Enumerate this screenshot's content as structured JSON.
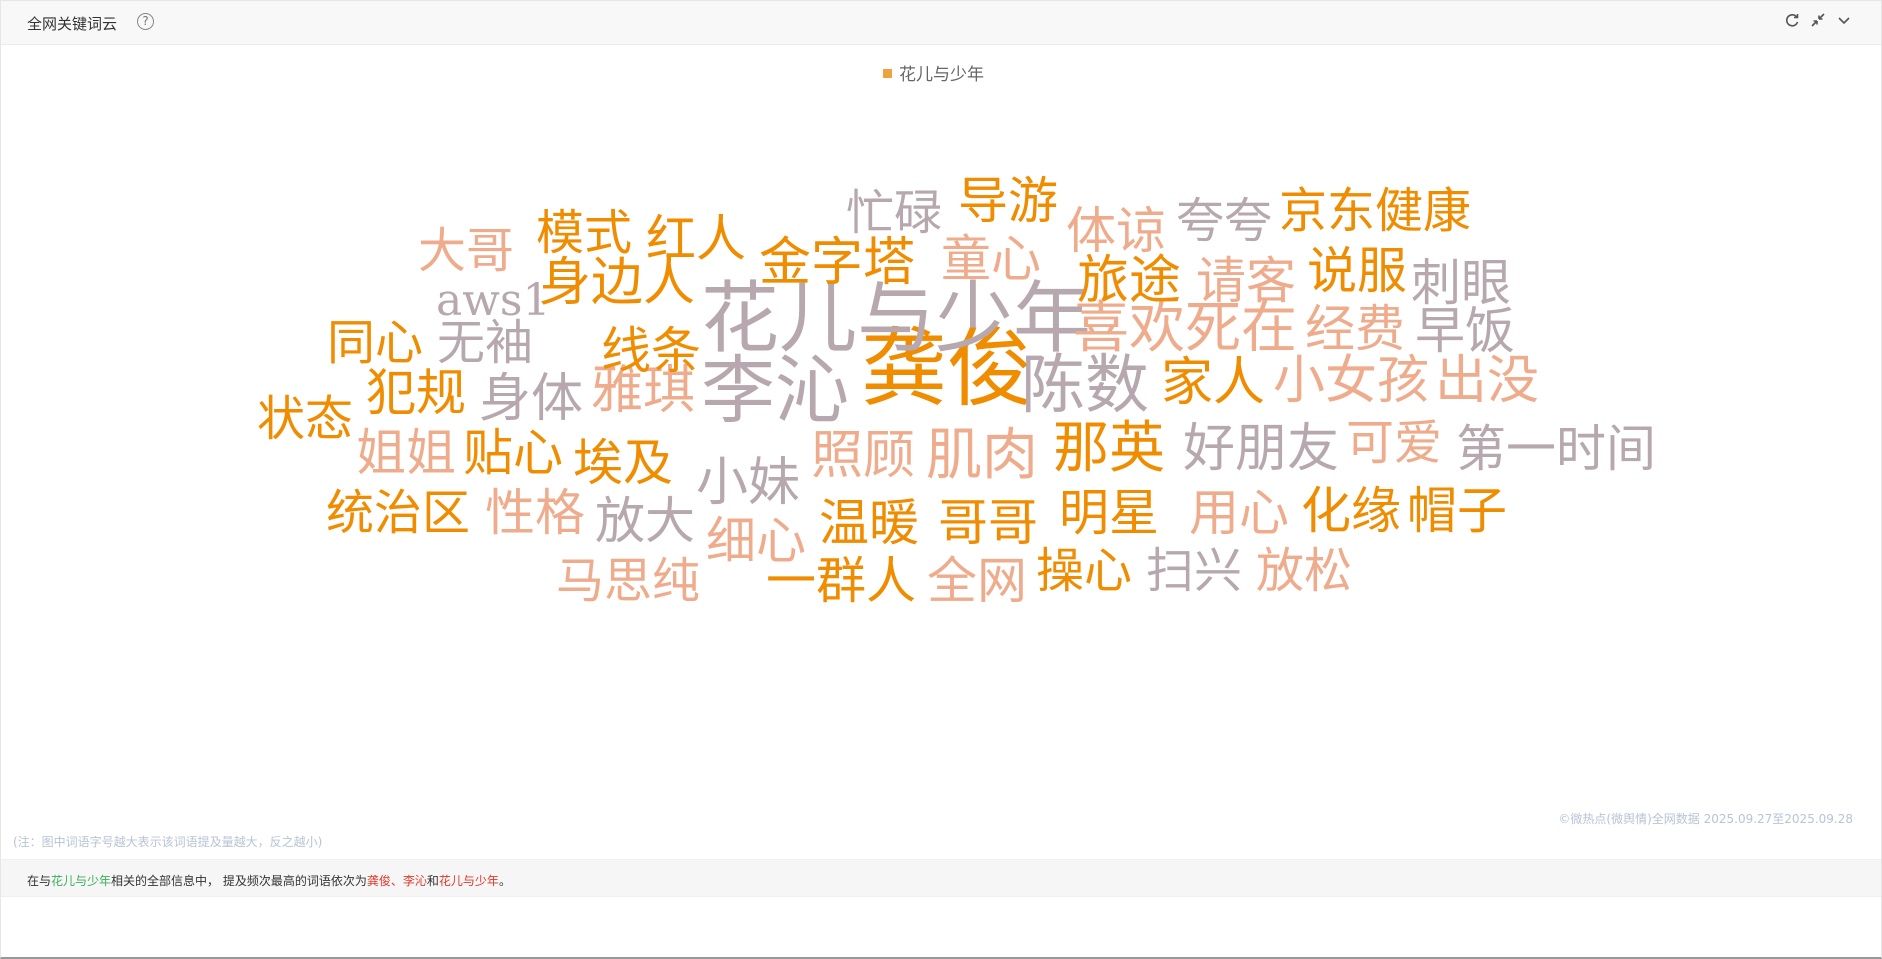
{
  "header": {
    "title": "全网关键词云",
    "help_icon": "question-circle-icon",
    "tools": [
      "refresh-icon",
      "collapse-icon",
      "chevron-down-icon"
    ]
  },
  "legend": {
    "label": "花儿与少年",
    "color": "#f0a23d"
  },
  "colors": {
    "orange": "#f08c00",
    "salmon": "#efac8c",
    "gray": "#b6a8ae"
  },
  "words": [
    {
      "text": "龚俊",
      "rank": 1,
      "color": "orange"
    },
    {
      "text": "李沁",
      "rank": 2,
      "color": "gray"
    },
    {
      "text": "花儿与少年",
      "rank": 3,
      "color": "gray"
    },
    {
      "text": "陈数",
      "rank": 4,
      "color": "gray"
    },
    {
      "text": "那英",
      "rank": 5,
      "color": "orange"
    },
    {
      "text": "肌肉",
      "rank": 6,
      "color": "salmon"
    },
    {
      "text": "家人",
      "rank": 7,
      "color": "orange"
    },
    {
      "text": "喜欢死在",
      "rank": 8,
      "color": "salmon"
    },
    {
      "text": "小女孩",
      "rank": 9,
      "color": "salmon"
    },
    {
      "text": "出没",
      "rank": 10,
      "color": "salmon"
    },
    {
      "text": "好朋友",
      "rank": 11,
      "color": "gray"
    },
    {
      "text": "第一时间",
      "rank": 12,
      "color": "gray"
    },
    {
      "text": "金字塔",
      "rank": 13,
      "color": "orange"
    },
    {
      "text": "身边人",
      "rank": 14,
      "color": "orange"
    },
    {
      "text": "雅琪",
      "rank": 15,
      "color": "salmon"
    },
    {
      "text": "照顾",
      "rank": 16,
      "color": "salmon"
    },
    {
      "text": "旅途",
      "rank": 17,
      "color": "orange"
    },
    {
      "text": "明星",
      "rank": 18,
      "color": "orange"
    },
    {
      "text": "温暖",
      "rank": 19,
      "color": "orange"
    },
    {
      "text": "哥哥",
      "rank": 20,
      "color": "orange"
    },
    {
      "text": "京东健康",
      "rank": 21,
      "color": "orange"
    },
    {
      "text": "小妹",
      "rank": 22,
      "color": "gray"
    },
    {
      "text": "埃及",
      "rank": 23,
      "color": "orange"
    },
    {
      "text": "犯规",
      "rank": 24,
      "color": "orange"
    },
    {
      "text": "身体",
      "rank": 25,
      "color": "gray"
    },
    {
      "text": "贴心",
      "rank": 26,
      "color": "orange"
    },
    {
      "text": "姐姐",
      "rank": 27,
      "color": "salmon"
    },
    {
      "text": "统治区",
      "rank": 28,
      "color": "orange"
    },
    {
      "text": "性格",
      "rank": 29,
      "color": "salmon"
    },
    {
      "text": "放大",
      "rank": 30,
      "color": "gray"
    },
    {
      "text": "细心",
      "rank": 31,
      "color": "salmon"
    },
    {
      "text": "一群人",
      "rank": 32,
      "color": "orange"
    },
    {
      "text": "全网",
      "rank": 33,
      "color": "salmon"
    },
    {
      "text": "操心",
      "rank": 34,
      "color": "orange"
    },
    {
      "text": "扫兴",
      "rank": 35,
      "color": "gray"
    },
    {
      "text": "放松",
      "rank": 36,
      "color": "salmon"
    },
    {
      "text": "马思纯",
      "rank": 37,
      "color": "salmon"
    },
    {
      "text": "用心",
      "rank": 38,
      "color": "salmon"
    },
    {
      "text": "化缘",
      "rank": 39,
      "color": "orange"
    },
    {
      "text": "帽子",
      "rank": 40,
      "color": "orange"
    },
    {
      "text": "可爱",
      "rank": 41,
      "color": "salmon"
    },
    {
      "text": "经费",
      "rank": 42,
      "color": "salmon"
    },
    {
      "text": "早饭",
      "rank": 43,
      "color": "gray"
    },
    {
      "text": "说服",
      "rank": 44,
      "color": "orange"
    },
    {
      "text": "刺眼",
      "rank": 45,
      "color": "gray"
    },
    {
      "text": "请客",
      "rank": 46,
      "color": "salmon"
    },
    {
      "text": "夸夸",
      "rank": 47,
      "color": "gray"
    },
    {
      "text": "体谅",
      "rank": 48,
      "color": "salmon"
    },
    {
      "text": "童心",
      "rank": 49,
      "color": "salmon"
    },
    {
      "text": "导游",
      "rank": 50,
      "color": "orange"
    },
    {
      "text": "忙碌",
      "rank": 51,
      "color": "gray"
    },
    {
      "text": "红人",
      "rank": 52,
      "color": "orange"
    },
    {
      "text": "模式",
      "rank": 53,
      "color": "orange"
    },
    {
      "text": "大哥",
      "rank": 54,
      "color": "salmon"
    },
    {
      "text": "aws1",
      "rank": 55,
      "color": "gray"
    },
    {
      "text": "同心",
      "rank": 56,
      "color": "orange"
    },
    {
      "text": "无袖",
      "rank": 57,
      "color": "gray"
    },
    {
      "text": "线条",
      "rank": 58,
      "color": "orange"
    },
    {
      "text": "状态",
      "rank": 59,
      "color": "orange"
    }
  ],
  "footer": {
    "source": "©微热点(微舆情)全网数据 2025.09.27至2025.09.28",
    "note": "(注：图中词语字号越大表示该词语提及量越大，反之越小)"
  },
  "summary": {
    "prefix": "在与",
    "subject": "花儿与少年",
    "middle": "相关的全部信息中，  提及频次最高的词语依次为",
    "top1": "龚俊",
    "sep1": "、",
    "top2": "李沁",
    "sep2": "和",
    "top3": "花儿与少年",
    "end": "。"
  }
}
